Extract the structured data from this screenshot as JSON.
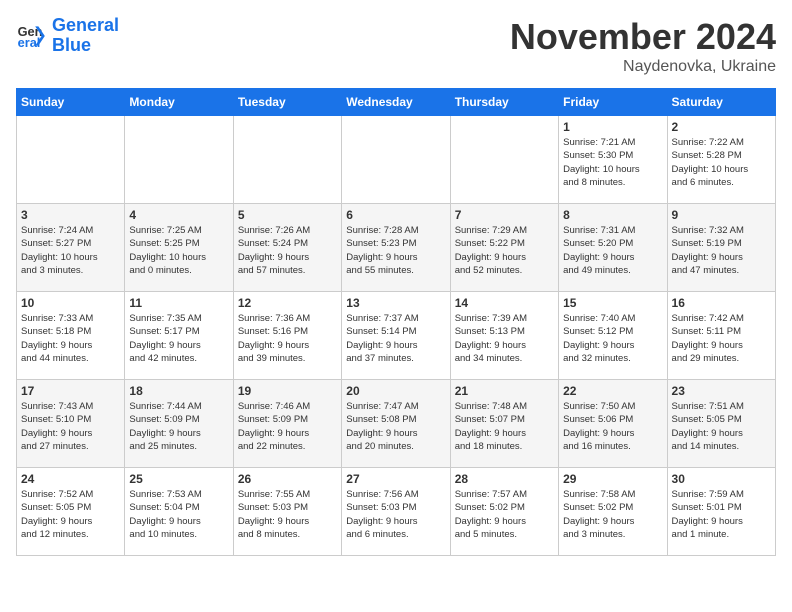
{
  "header": {
    "logo_line1": "General",
    "logo_line2": "Blue",
    "month_title": "November 2024",
    "location": "Naydenovka, Ukraine"
  },
  "days_of_week": [
    "Sunday",
    "Monday",
    "Tuesday",
    "Wednesday",
    "Thursday",
    "Friday",
    "Saturday"
  ],
  "weeks": [
    [
      {
        "day": "",
        "info": ""
      },
      {
        "day": "",
        "info": ""
      },
      {
        "day": "",
        "info": ""
      },
      {
        "day": "",
        "info": ""
      },
      {
        "day": "",
        "info": ""
      },
      {
        "day": "1",
        "info": "Sunrise: 7:21 AM\nSunset: 5:30 PM\nDaylight: 10 hours\nand 8 minutes."
      },
      {
        "day": "2",
        "info": "Sunrise: 7:22 AM\nSunset: 5:28 PM\nDaylight: 10 hours\nand 6 minutes."
      }
    ],
    [
      {
        "day": "3",
        "info": "Sunrise: 7:24 AM\nSunset: 5:27 PM\nDaylight: 10 hours\nand 3 minutes."
      },
      {
        "day": "4",
        "info": "Sunrise: 7:25 AM\nSunset: 5:25 PM\nDaylight: 10 hours\nand 0 minutes."
      },
      {
        "day": "5",
        "info": "Sunrise: 7:26 AM\nSunset: 5:24 PM\nDaylight: 9 hours\nand 57 minutes."
      },
      {
        "day": "6",
        "info": "Sunrise: 7:28 AM\nSunset: 5:23 PM\nDaylight: 9 hours\nand 55 minutes."
      },
      {
        "day": "7",
        "info": "Sunrise: 7:29 AM\nSunset: 5:22 PM\nDaylight: 9 hours\nand 52 minutes."
      },
      {
        "day": "8",
        "info": "Sunrise: 7:31 AM\nSunset: 5:20 PM\nDaylight: 9 hours\nand 49 minutes."
      },
      {
        "day": "9",
        "info": "Sunrise: 7:32 AM\nSunset: 5:19 PM\nDaylight: 9 hours\nand 47 minutes."
      }
    ],
    [
      {
        "day": "10",
        "info": "Sunrise: 7:33 AM\nSunset: 5:18 PM\nDaylight: 9 hours\nand 44 minutes."
      },
      {
        "day": "11",
        "info": "Sunrise: 7:35 AM\nSunset: 5:17 PM\nDaylight: 9 hours\nand 42 minutes."
      },
      {
        "day": "12",
        "info": "Sunrise: 7:36 AM\nSunset: 5:16 PM\nDaylight: 9 hours\nand 39 minutes."
      },
      {
        "day": "13",
        "info": "Sunrise: 7:37 AM\nSunset: 5:14 PM\nDaylight: 9 hours\nand 37 minutes."
      },
      {
        "day": "14",
        "info": "Sunrise: 7:39 AM\nSunset: 5:13 PM\nDaylight: 9 hours\nand 34 minutes."
      },
      {
        "day": "15",
        "info": "Sunrise: 7:40 AM\nSunset: 5:12 PM\nDaylight: 9 hours\nand 32 minutes."
      },
      {
        "day": "16",
        "info": "Sunrise: 7:42 AM\nSunset: 5:11 PM\nDaylight: 9 hours\nand 29 minutes."
      }
    ],
    [
      {
        "day": "17",
        "info": "Sunrise: 7:43 AM\nSunset: 5:10 PM\nDaylight: 9 hours\nand 27 minutes."
      },
      {
        "day": "18",
        "info": "Sunrise: 7:44 AM\nSunset: 5:09 PM\nDaylight: 9 hours\nand 25 minutes."
      },
      {
        "day": "19",
        "info": "Sunrise: 7:46 AM\nSunset: 5:09 PM\nDaylight: 9 hours\nand 22 minutes."
      },
      {
        "day": "20",
        "info": "Sunrise: 7:47 AM\nSunset: 5:08 PM\nDaylight: 9 hours\nand 20 minutes."
      },
      {
        "day": "21",
        "info": "Sunrise: 7:48 AM\nSunset: 5:07 PM\nDaylight: 9 hours\nand 18 minutes."
      },
      {
        "day": "22",
        "info": "Sunrise: 7:50 AM\nSunset: 5:06 PM\nDaylight: 9 hours\nand 16 minutes."
      },
      {
        "day": "23",
        "info": "Sunrise: 7:51 AM\nSunset: 5:05 PM\nDaylight: 9 hours\nand 14 minutes."
      }
    ],
    [
      {
        "day": "24",
        "info": "Sunrise: 7:52 AM\nSunset: 5:05 PM\nDaylight: 9 hours\nand 12 minutes."
      },
      {
        "day": "25",
        "info": "Sunrise: 7:53 AM\nSunset: 5:04 PM\nDaylight: 9 hours\nand 10 minutes."
      },
      {
        "day": "26",
        "info": "Sunrise: 7:55 AM\nSunset: 5:03 PM\nDaylight: 9 hours\nand 8 minutes."
      },
      {
        "day": "27",
        "info": "Sunrise: 7:56 AM\nSunset: 5:03 PM\nDaylight: 9 hours\nand 6 minutes."
      },
      {
        "day": "28",
        "info": "Sunrise: 7:57 AM\nSunset: 5:02 PM\nDaylight: 9 hours\nand 5 minutes."
      },
      {
        "day": "29",
        "info": "Sunrise: 7:58 AM\nSunset: 5:02 PM\nDaylight: 9 hours\nand 3 minutes."
      },
      {
        "day": "30",
        "info": "Sunrise: 7:59 AM\nSunset: 5:01 PM\nDaylight: 9 hours\nand 1 minute."
      }
    ]
  ]
}
